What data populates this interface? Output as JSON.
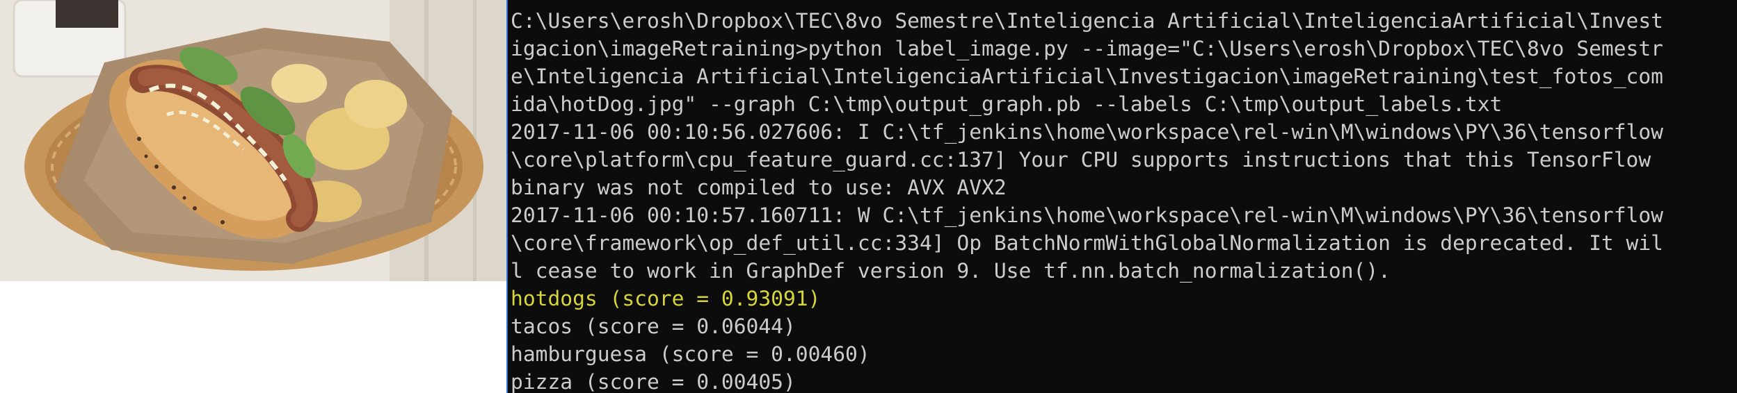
{
  "image": {
    "caption": "",
    "colors": {
      "background": "#ffffff",
      "basket": "#c99a5a",
      "paper": "#a98a6e",
      "bun": "#d9a15f",
      "relish": "#6aa04b"
    }
  },
  "console": {
    "colors": {
      "background": "#0c0c0c",
      "text": "#cccccc",
      "highlight": "#d6d63a",
      "border": "#2f6fd6"
    },
    "lines": [
      {
        "text": "C:\\Users\\erosh\\Dropbox\\TEC\\8vo Semestre\\Inteligencia Artificial\\InteligenciaArtificial\\Invest",
        "highlight": false
      },
      {
        "text": "igacion\\imageRetraining>python label_image.py --image=\"C:\\Users\\erosh\\Dropbox\\TEC\\8vo Semestr",
        "highlight": false
      },
      {
        "text": "e\\Inteligencia Artificial\\InteligenciaArtificial\\Investigacion\\imageRetraining\\test_fotos_com",
        "highlight": false
      },
      {
        "text": "ida\\hotDog.jpg\" --graph C:\\tmp\\output_graph.pb --labels C:\\tmp\\output_labels.txt",
        "highlight": false
      },
      {
        "text": "2017-11-06 00:10:56.027606: I C:\\tf_jenkins\\home\\workspace\\rel-win\\M\\windows\\PY\\36\\tensorflow",
        "highlight": false
      },
      {
        "text": "\\core\\platform\\cpu_feature_guard.cc:137] Your CPU supports instructions that this TensorFlow",
        "highlight": false
      },
      {
        "text": "binary was not compiled to use: AVX AVX2",
        "highlight": false
      },
      {
        "text": "2017-11-06 00:10:57.160711: W C:\\tf_jenkins\\home\\workspace\\rel-win\\M\\windows\\PY\\36\\tensorflow",
        "highlight": false
      },
      {
        "text": "\\core\\framework\\op_def_util.cc:334] Op BatchNormWithGlobalNormalization is deprecated. It wil",
        "highlight": false
      },
      {
        "text": "l cease to work in GraphDef version 9. Use tf.nn.batch_normalization().",
        "highlight": false
      },
      {
        "text": "hotdogs (score = 0.93091)",
        "highlight": true
      },
      {
        "text": "tacos (score = 0.06044)",
        "highlight": false
      },
      {
        "text": "hamburguesa (score = 0.00460)",
        "highlight": false
      },
      {
        "text": "pizza (score = 0.00405)",
        "highlight": false
      }
    ]
  }
}
